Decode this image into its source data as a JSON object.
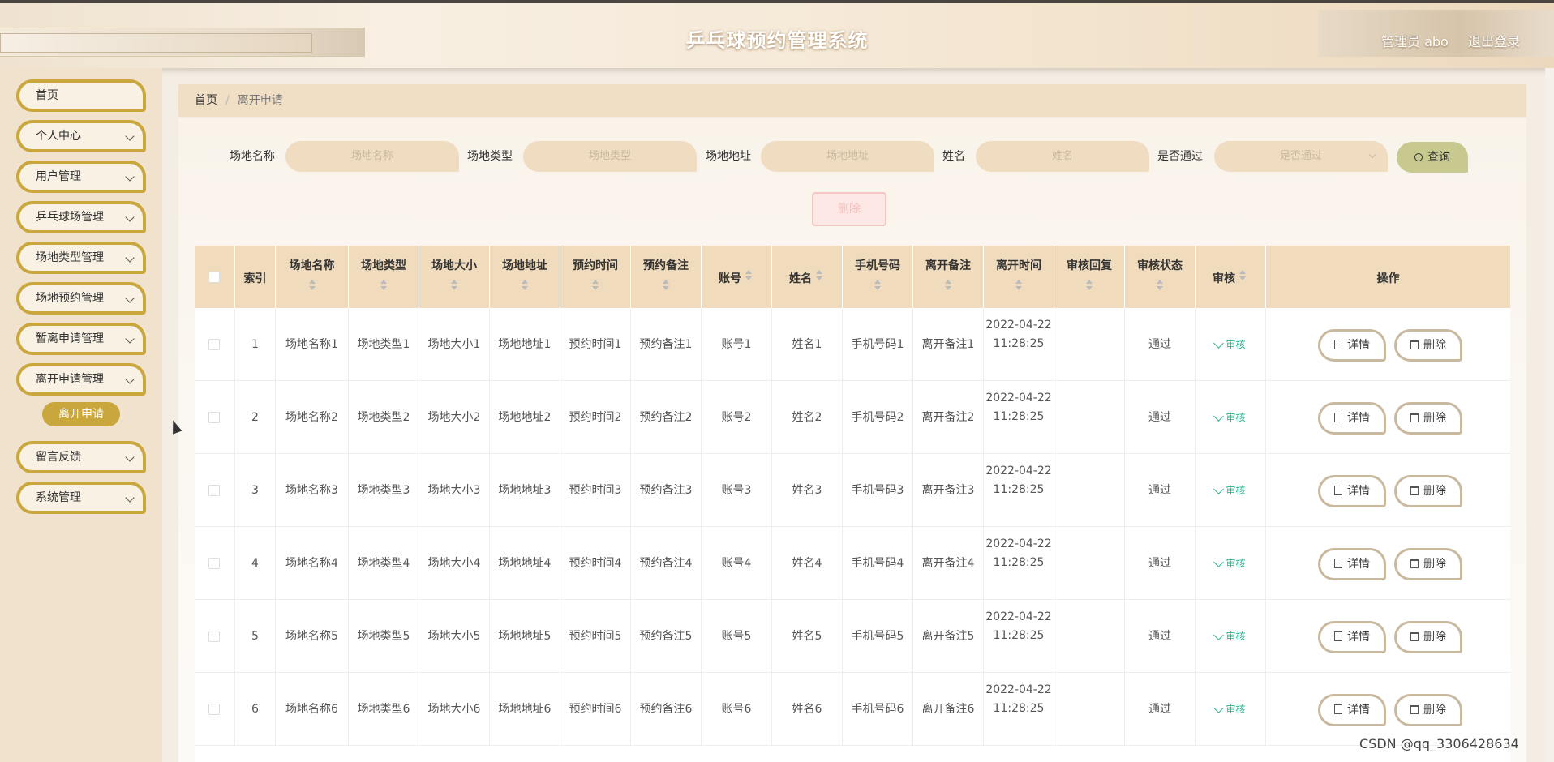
{
  "header": {
    "title": "乒乓球预约管理系统",
    "admin_label": "管理员 abo",
    "logout_label": "退出登录"
  },
  "sidebar": {
    "items": [
      {
        "label": "首页",
        "has_children": false
      },
      {
        "label": "个人中心",
        "has_children": true
      },
      {
        "label": "用户管理",
        "has_children": true
      },
      {
        "label": "乒乓球场管理",
        "has_children": true
      },
      {
        "label": "场地类型管理",
        "has_children": true
      },
      {
        "label": "场地预约管理",
        "has_children": true
      },
      {
        "label": "暂离申请管理",
        "has_children": true
      },
      {
        "label": "离开申请管理",
        "has_children": true
      },
      {
        "label": "留言反馈",
        "has_children": true
      },
      {
        "label": "系统管理",
        "has_children": true
      }
    ],
    "active_sub": "离开申请"
  },
  "breadcrumb": {
    "home": "首页",
    "separator": "/",
    "current": "离开申请"
  },
  "search": {
    "fields": [
      {
        "label": "场地名称",
        "placeholder": "场地名称"
      },
      {
        "label": "场地类型",
        "placeholder": "场地类型"
      },
      {
        "label": "场地地址",
        "placeholder": "场地地址"
      },
      {
        "label": "姓名",
        "placeholder": "姓名"
      },
      {
        "label": "是否通过",
        "placeholder": "是否通过"
      }
    ],
    "query_label": "查询",
    "bulk_delete_label": "删除"
  },
  "table": {
    "columns": [
      "",
      "索引",
      "场地名称",
      "场地类型",
      "场地大小",
      "场地地址",
      "预约时间",
      "预约备注",
      "账号",
      "姓名",
      "手机号码",
      "离开备注",
      "离开时间",
      "审核回复",
      "审核状态",
      "审核",
      "操作"
    ],
    "rows": [
      {
        "index": "1",
        "name": "场地名称1",
        "type": "场地类型1",
        "size": "场地大小1",
        "address": "场地地址1",
        "reserve_time": "预约时间1",
        "reserve_note": "预约备注1",
        "account": "账号1",
        "person": "姓名1",
        "phone": "手机号码1",
        "leave_note": "离开备注1",
        "leave_time": "2022-04-22 11:28:25",
        "reply": "",
        "status": "通过",
        "audit": "审核"
      },
      {
        "index": "2",
        "name": "场地名称2",
        "type": "场地类型2",
        "size": "场地大小2",
        "address": "场地地址2",
        "reserve_time": "预约时间2",
        "reserve_note": "预约备注2",
        "account": "账号2",
        "person": "姓名2",
        "phone": "手机号码2",
        "leave_note": "离开备注2",
        "leave_time": "2022-04-22 11:28:25",
        "reply": "",
        "status": "通过",
        "audit": "审核"
      },
      {
        "index": "3",
        "name": "场地名称3",
        "type": "场地类型3",
        "size": "场地大小3",
        "address": "场地地址3",
        "reserve_time": "预约时间3",
        "reserve_note": "预约备注3",
        "account": "账号3",
        "person": "姓名3",
        "phone": "手机号码3",
        "leave_note": "离开备注3",
        "leave_time": "2022-04-22 11:28:25",
        "reply": "",
        "status": "通过",
        "audit": "审核"
      },
      {
        "index": "4",
        "name": "场地名称4",
        "type": "场地类型4",
        "size": "场地大小4",
        "address": "场地地址4",
        "reserve_time": "预约时间4",
        "reserve_note": "预约备注4",
        "account": "账号4",
        "person": "姓名4",
        "phone": "手机号码4",
        "leave_note": "离开备注4",
        "leave_time": "2022-04-22 11:28:25",
        "reply": "",
        "status": "通过",
        "audit": "审核"
      },
      {
        "index": "5",
        "name": "场地名称5",
        "type": "场地类型5",
        "size": "场地大小5",
        "address": "场地地址5",
        "reserve_time": "预约时间5",
        "reserve_note": "预约备注5",
        "account": "账号5",
        "person": "姓名5",
        "phone": "手机号码5",
        "leave_note": "离开备注5",
        "leave_time": "2022-04-22 11:28:25",
        "reply": "",
        "status": "通过",
        "audit": "审核"
      },
      {
        "index": "6",
        "name": "场地名称6",
        "type": "场地类型6",
        "size": "场地大小6",
        "address": "场地地址6",
        "reserve_time": "预约时间6",
        "reserve_note": "预约备注6",
        "account": "账号6",
        "person": "姓名6",
        "phone": "手机号码6",
        "leave_note": "离开备注6",
        "leave_time": "2022-04-22 11:28:25",
        "reply": "",
        "status": "通过",
        "audit": "审核"
      }
    ],
    "detail_label": "详情",
    "delete_label": "删除"
  },
  "watermark": "CSDN @qq_3306428634",
  "colors": {
    "accent_gold": "#c9a73d",
    "header_bg": "#f0dcbd",
    "audit_green": "#2bb38c",
    "query_btn": "#c8c98e"
  }
}
